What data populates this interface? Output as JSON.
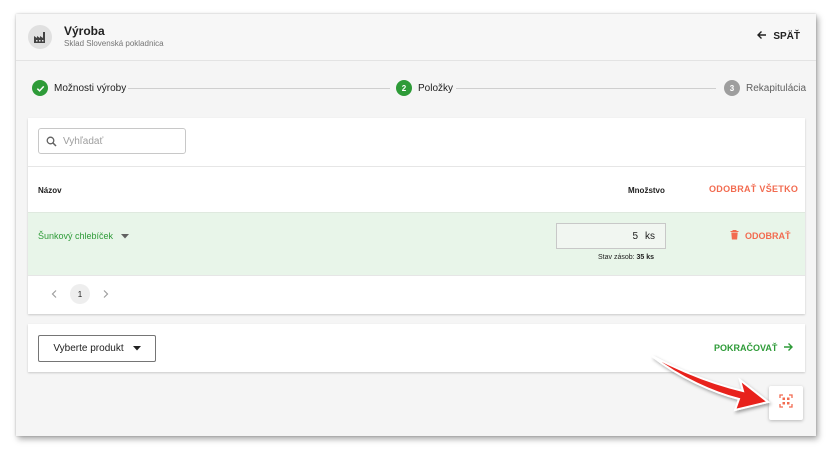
{
  "header": {
    "title": "Výroba",
    "subtitle": "Sklad Slovenská pokladnica",
    "back_label": "SPÄŤ"
  },
  "stepper": {
    "steps": [
      {
        "label": "Možnosti výroby",
        "number": "",
        "state": "done"
      },
      {
        "label": "Položky",
        "number": "2",
        "state": "active"
      },
      {
        "label": "Rekapitulácia",
        "number": "3",
        "state": "pending"
      }
    ]
  },
  "search": {
    "placeholder": "Vyhľadať"
  },
  "table": {
    "col_name": "Názov",
    "col_qty": "Množstvo",
    "remove_all": "ODOBRAŤ VŠETKO",
    "rows": [
      {
        "name": "Šunkový chlebíček",
        "qty": "5",
        "unit": "ks",
        "stock_label": "Stav zásob:",
        "stock_value": "35 ks",
        "remove": "ODOBRAŤ"
      }
    ]
  },
  "pagination": {
    "current": "1"
  },
  "actions": {
    "select_product": "Vyberte produkt",
    "continue": "POKRAČOVAŤ"
  },
  "colors": {
    "primary_green": "#2e9b38",
    "accent_red": "#f26b50",
    "row_highlight": "#e8f5e9",
    "annotation_arrow": "#e8211b"
  },
  "icons": [
    "factory-icon",
    "arrow-left-icon",
    "check-icon",
    "search-icon",
    "caret-down-icon",
    "trash-icon",
    "chevron-left-icon",
    "chevron-right-icon",
    "arrow-right-icon",
    "qr-scan-icon"
  ]
}
